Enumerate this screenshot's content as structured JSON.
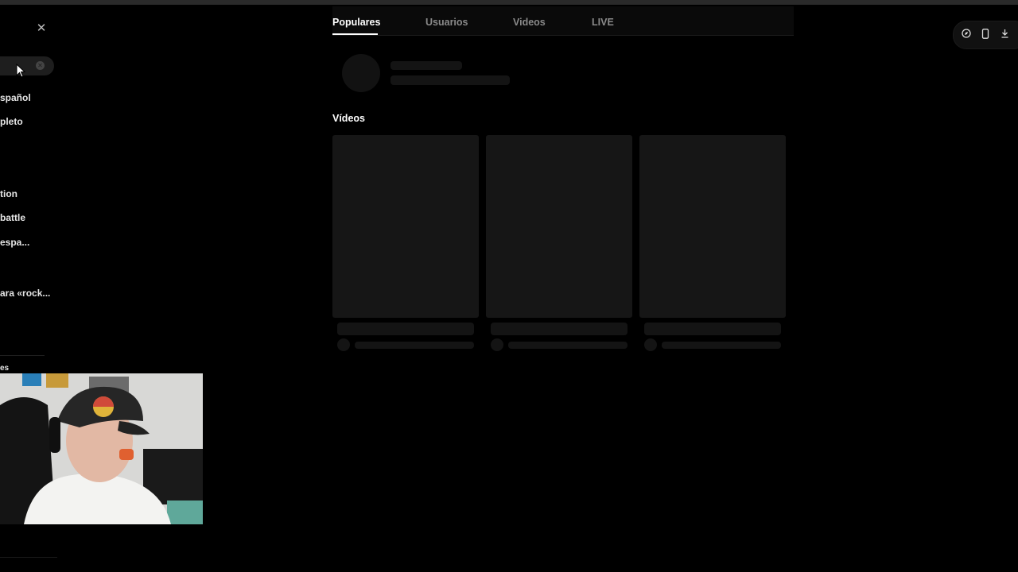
{
  "tabs": [
    {
      "label": "Populares",
      "active": true
    },
    {
      "label": "Usuarios",
      "active": false
    },
    {
      "label": "Videos",
      "active": false
    },
    {
      "label": "LIVE",
      "active": false
    }
  ],
  "section_title": "Vídeos",
  "suggestions": [
    {
      "label": "spañol"
    },
    {
      "label": "pleto"
    },
    {
      "label": "tion"
    },
    {
      "label": "battle"
    },
    {
      "label": "espa..."
    },
    {
      "label": "ara «rock..."
    },
    {
      "label": "es"
    }
  ],
  "icons": {
    "close": "close-icon",
    "clear": "clear-search-icon",
    "cursor": "mouse-cursor",
    "toolbar": [
      "compass-icon",
      "phone-icon",
      "download-icon"
    ]
  },
  "colors": {
    "background": "#000000",
    "skeleton": "#161616",
    "active_tab": "#ffffff",
    "inactive_tab": "#8a8a8a"
  }
}
